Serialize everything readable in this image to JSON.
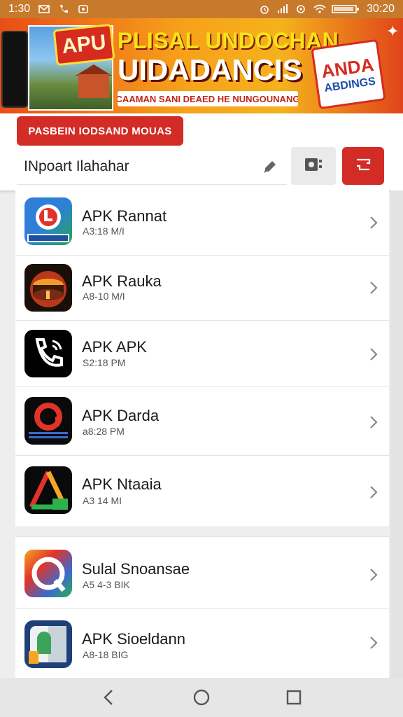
{
  "status_bar": {
    "time": "1:30",
    "right_time": "30:20"
  },
  "banner": {
    "logo_text": "APU",
    "title_line1": "PLISAL UNDOCHAN",
    "title_line2": "UIDADANCIS",
    "subtitle": "CAAMAN SANI DEAED HE NUNGOUNANG",
    "badge_line1": "ANDA",
    "badge_line2": "ABDINGS"
  },
  "tag_button": {
    "label": "PASBEIN IODSAND MOUAS"
  },
  "search": {
    "value": "INpoart Ilahahar",
    "placeholder": "INpoart Ilahahar"
  },
  "apps": [
    {
      "name": "APK Rannat",
      "meta": "A3:18 M/I",
      "icon": "app-icon-red-blue"
    },
    {
      "name": "APK Rauka",
      "meta": "A8-10 M/I",
      "icon": "app-icon-orange-drum"
    },
    {
      "name": "APK APK",
      "meta": "S2:18 PM",
      "icon": "phone-app-icon"
    },
    {
      "name": "APK Darda",
      "meta": "a8:28 PM",
      "icon": "app-icon-red-ring"
    },
    {
      "name": "APK Ntaaia",
      "meta": "A3 14 MI",
      "icon": "app-icon-triangle"
    },
    {
      "name": "Sulal Snoansae",
      "meta": "A5 4-3 BIK",
      "icon": "app-icon-colorful"
    },
    {
      "name": "APK Sioeldann",
      "meta": "A8-18 BIG",
      "icon": "app-icon-android"
    }
  ],
  "colors": {
    "accent": "#d32b25",
    "status_bar": "#c77a2c"
  }
}
